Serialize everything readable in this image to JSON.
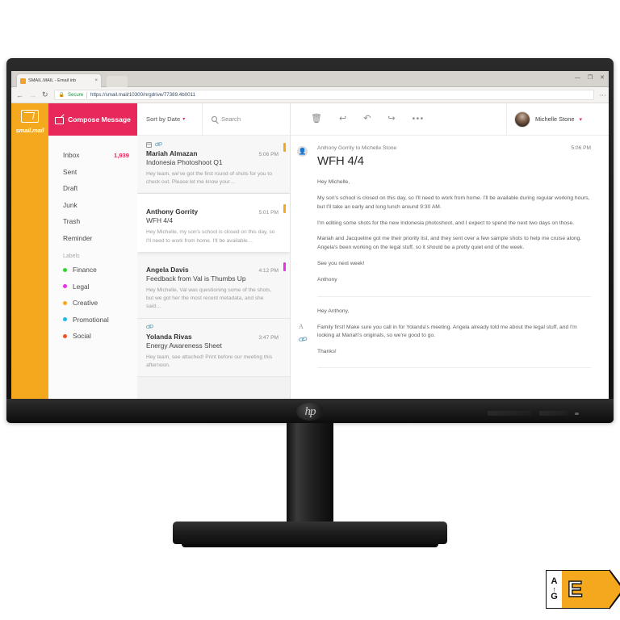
{
  "browser": {
    "tab_title": "SMAIL.MAIL - Email inb",
    "tab_close": "×",
    "back_icon": "←",
    "forward_icon": "→",
    "reload_icon": "↻",
    "lock_icon": "🔒",
    "secure_label": "Secure",
    "url": "https://smail.mail/10300/nrgdrive/77389.4b0011",
    "minimize": "—",
    "maximize": "❐",
    "close": "✕",
    "menu_icon": "⋮"
  },
  "brand": {
    "name": "smail.mail"
  },
  "sidebar": {
    "compose_label": "Compose Message",
    "items": [
      {
        "label": "Inbox",
        "count": "1,939"
      },
      {
        "label": "Sent",
        "count": ""
      },
      {
        "label": "Draft",
        "count": ""
      },
      {
        "label": "Junk",
        "count": ""
      },
      {
        "label": "Trash",
        "count": ""
      },
      {
        "label": "Reminder",
        "count": ""
      }
    ],
    "labels_heading": "Labels",
    "labels": [
      {
        "label": "Finance",
        "color": "#2fd62f"
      },
      {
        "label": "Legal",
        "color": "#e830e8"
      },
      {
        "label": "Creative",
        "color": "#f4a81d"
      },
      {
        "label": "Promotional",
        "color": "#1fb6e8"
      },
      {
        "label": "Social",
        "color": "#f0512a"
      }
    ]
  },
  "list_toolbar": {
    "sort_label": "Sort by Date",
    "sort_caret": "▾",
    "search_placeholder": "Search"
  },
  "messages": [
    {
      "from": "Mariah Almazan",
      "time": "5:06 PM",
      "subject": "Indonesia Photoshoot Q1",
      "preview": "Hey team, we've got the first round of shots for you to check out. Please let me know your…",
      "accent": "#f4a81d",
      "has_calendar": true,
      "has_attachment": true,
      "active": false
    },
    {
      "from": "Anthony Gorrity",
      "time": "5:01 PM",
      "subject": "WFH 4/4",
      "preview": "Hey Michelle, my son's school is closed on this day, so I'll need to work from home. I'll be available…",
      "accent": "#f4a81d",
      "has_calendar": false,
      "has_attachment": false,
      "active": true
    },
    {
      "from": "Angela Davis",
      "time": "4:12 PM",
      "subject": "Feedback from Val is Thumbs Up",
      "preview": "Hey Michelle, Val was questioning some of the shots, but we got her the most recent metadata, and she said…",
      "accent": "#e830e8",
      "has_calendar": false,
      "has_attachment": false,
      "active": false
    },
    {
      "from": "Yolanda Rivas",
      "time": "3:47 PM",
      "subject": "Energy Awareness Sheet",
      "preview": "Hey team, see attached! Print before our meeting this afternoon.",
      "accent": "",
      "has_calendar": false,
      "has_attachment": true,
      "active": false
    }
  ],
  "read_toolbar": {
    "delete_icon": "🗑",
    "reply_icon": "↩",
    "reply_all_icon": "↶",
    "forward_icon": "↪",
    "more_icon": "•••",
    "user_name": "Michelle Stone",
    "user_caret": "▾"
  },
  "reading": {
    "avatar_icon": "👤",
    "participants": "Anthony Gorrity to Michelle Stone",
    "time": "5:06 PM",
    "subject": "WFH 4/4",
    "paragraphs": [
      "Hey Michelle,",
      "My son's school is closed on this day, so I'll need to work from home. I'll be available during regular working hours, but I'll take an early and long lunch around 9:30 AM.",
      "I'm editing some shots for the new Indonesia photoshoot, and I expect to spend the next two days on those.",
      "Mariah and Jacqueline got me their priority list, and they sent over a few sample shots to help me cruise along. Angela's been working on the legal stuff, so it should be a pretty quiet end of the week.",
      "See you next week!",
      "Anthony"
    ],
    "reply_font_icon": "A",
    "reply_attach_icon": "📎",
    "reply_paragraphs": [
      "Hey Anthony,",
      "Family first! Make sure you call in for Yolanda's meeting. Angela already told me about the legal stuff, and I'm looking at Mariah's originals, so we're good to go.",
      "Thanks!"
    ]
  },
  "monitor": {
    "hp_logo": "hp"
  },
  "energy_label": {
    "scale_top": "A",
    "scale_arrow": "↑",
    "scale_bottom": "G",
    "class": "E",
    "accent": "#f4a81d"
  }
}
